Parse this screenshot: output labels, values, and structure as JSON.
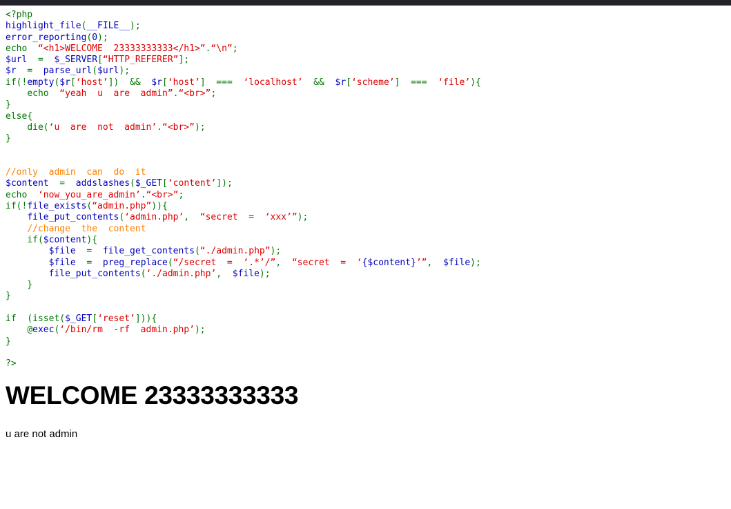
{
  "chrome": {
    "top_bar_color": "#22222a"
  },
  "syntax_colors": {
    "default": "#0000BB",
    "keyword": "#007700",
    "string": "#DD0000",
    "comment": "#FF8000",
    "html": "#000000",
    "background": "#FFFFFF"
  },
  "source_code": {
    "language": "php",
    "lines": [
      [
        {
          "t": "&lt;?php",
          "c": "keyword"
        }
      ],
      [
        {
          "t": "highlight_file",
          "c": "default"
        },
        {
          "t": "(",
          "c": "keyword"
        },
        {
          "t": "__FILE__",
          "c": "default"
        },
        {
          "t": ")",
          "c": "keyword"
        },
        {
          "t": ";",
          "c": "keyword"
        }
      ],
      [
        {
          "t": "error_reporting",
          "c": "default"
        },
        {
          "t": "(",
          "c": "keyword"
        },
        {
          "t": "0",
          "c": "default"
        },
        {
          "t": ")",
          "c": "keyword"
        },
        {
          "t": ";",
          "c": "keyword"
        }
      ],
      [
        {
          "t": "echo ",
          "c": "keyword"
        },
        {
          "t": " “&lt;h1&gt;WELCOME  23333333333&lt;/h1&gt;”",
          "c": "string"
        },
        {
          "t": ".",
          "c": "keyword"
        },
        {
          "t": "“\\n”",
          "c": "string"
        },
        {
          "t": ";",
          "c": "keyword"
        }
      ],
      [
        {
          "t": "$url",
          "c": "default"
        },
        {
          "t": "  =  ",
          "c": "keyword"
        },
        {
          "t": "$_SERVER",
          "c": "default"
        },
        {
          "t": "[",
          "c": "keyword"
        },
        {
          "t": "“HTTP_REFERER”",
          "c": "string"
        },
        {
          "t": "]",
          "c": "keyword"
        },
        {
          "t": ";",
          "c": "keyword"
        }
      ],
      [
        {
          "t": "$r",
          "c": "default"
        },
        {
          "t": "  =  ",
          "c": "keyword"
        },
        {
          "t": "parse_url",
          "c": "default"
        },
        {
          "t": "(",
          "c": "keyword"
        },
        {
          "t": "$url",
          "c": "default"
        },
        {
          "t": ")",
          "c": "keyword"
        },
        {
          "t": ";",
          "c": "keyword"
        }
      ],
      [
        {
          "t": "if",
          "c": "keyword"
        },
        {
          "t": "(!",
          "c": "keyword"
        },
        {
          "t": "empty",
          "c": "default"
        },
        {
          "t": "(",
          "c": "keyword"
        },
        {
          "t": "$r",
          "c": "default"
        },
        {
          "t": "[",
          "c": "keyword"
        },
        {
          "t": "‘host’",
          "c": "string"
        },
        {
          "t": "])",
          "c": "keyword"
        },
        {
          "t": "  &amp;&amp;  ",
          "c": "keyword"
        },
        {
          "t": "$r",
          "c": "default"
        },
        {
          "t": "[",
          "c": "keyword"
        },
        {
          "t": "‘host’",
          "c": "string"
        },
        {
          "t": "]",
          "c": "keyword"
        },
        {
          "t": "  ===  ",
          "c": "keyword"
        },
        {
          "t": "‘localhost’",
          "c": "string"
        },
        {
          "t": "  &amp;&amp;  ",
          "c": "keyword"
        },
        {
          "t": "$r",
          "c": "default"
        },
        {
          "t": "[",
          "c": "keyword"
        },
        {
          "t": "‘scheme’",
          "c": "string"
        },
        {
          "t": "]",
          "c": "keyword"
        },
        {
          "t": "  ===  ",
          "c": "keyword"
        },
        {
          "t": "‘file’",
          "c": "string"
        },
        {
          "t": "){",
          "c": "keyword"
        }
      ],
      [
        {
          "t": "    ",
          "c": "keyword"
        },
        {
          "t": "echo ",
          "c": "keyword"
        },
        {
          "t": " “yeah  u  are  admin”",
          "c": "string"
        },
        {
          "t": ".",
          "c": "keyword"
        },
        {
          "t": "“&lt;br&gt;”",
          "c": "string"
        },
        {
          "t": ";",
          "c": "keyword"
        }
      ],
      [
        {
          "t": "}",
          "c": "keyword"
        }
      ],
      [
        {
          "t": "else",
          "c": "keyword"
        },
        {
          "t": "{",
          "c": "keyword"
        }
      ],
      [
        {
          "t": "    ",
          "c": "keyword"
        },
        {
          "t": "die",
          "c": "keyword"
        },
        {
          "t": "(",
          "c": "keyword"
        },
        {
          "t": "‘u  are  not  admin’",
          "c": "string"
        },
        {
          "t": ".",
          "c": "keyword"
        },
        {
          "t": "“&lt;br&gt;”",
          "c": "string"
        },
        {
          "t": ")",
          "c": "keyword"
        },
        {
          "t": ";",
          "c": "keyword"
        }
      ],
      [
        {
          "t": "}",
          "c": "keyword"
        }
      ],
      [],
      [],
      [
        {
          "t": "//only  admin  can  do  it",
          "c": "comment"
        }
      ],
      [
        {
          "t": "$content",
          "c": "default"
        },
        {
          "t": "  =  ",
          "c": "keyword"
        },
        {
          "t": "addslashes",
          "c": "default"
        },
        {
          "t": "(",
          "c": "keyword"
        },
        {
          "t": "$_GET",
          "c": "default"
        },
        {
          "t": "[",
          "c": "keyword"
        },
        {
          "t": "‘content’",
          "c": "string"
        },
        {
          "t": "])",
          "c": "keyword"
        },
        {
          "t": ";",
          "c": "keyword"
        }
      ],
      [
        {
          "t": "echo ",
          "c": "keyword"
        },
        {
          "t": " ‘now_you_are_admin’",
          "c": "string"
        },
        {
          "t": ".",
          "c": "keyword"
        },
        {
          "t": "“&lt;br&gt;”",
          "c": "string"
        },
        {
          "t": ";",
          "c": "keyword"
        }
      ],
      [
        {
          "t": "if",
          "c": "keyword"
        },
        {
          "t": "(!",
          "c": "keyword"
        },
        {
          "t": "file_exists",
          "c": "default"
        },
        {
          "t": "(",
          "c": "keyword"
        },
        {
          "t": "“admin.php”",
          "c": "string"
        },
        {
          "t": ")){",
          "c": "keyword"
        }
      ],
      [
        {
          "t": "    ",
          "c": "keyword"
        },
        {
          "t": "file_put_contents",
          "c": "default"
        },
        {
          "t": "(",
          "c": "keyword"
        },
        {
          "t": "‘admin.php’",
          "c": "string"
        },
        {
          "t": ",  ",
          "c": "keyword"
        },
        {
          "t": "“secret  =  ‘xxx’”",
          "c": "string"
        },
        {
          "t": ")",
          "c": "keyword"
        },
        {
          "t": ";",
          "c": "keyword"
        }
      ],
      [
        {
          "t": "    ",
          "c": "keyword"
        },
        {
          "t": "//change  the  content",
          "c": "comment"
        }
      ],
      [
        {
          "t": "    ",
          "c": "keyword"
        },
        {
          "t": "if",
          "c": "keyword"
        },
        {
          "t": "(",
          "c": "keyword"
        },
        {
          "t": "$content",
          "c": "default"
        },
        {
          "t": "){",
          "c": "keyword"
        }
      ],
      [
        {
          "t": "        ",
          "c": "keyword"
        },
        {
          "t": "$file",
          "c": "default"
        },
        {
          "t": "  =  ",
          "c": "keyword"
        },
        {
          "t": "file_get_contents",
          "c": "default"
        },
        {
          "t": "(",
          "c": "keyword"
        },
        {
          "t": "“./admin.php”",
          "c": "string"
        },
        {
          "t": ")",
          "c": "keyword"
        },
        {
          "t": ";",
          "c": "keyword"
        }
      ],
      [
        {
          "t": "        ",
          "c": "keyword"
        },
        {
          "t": "$file",
          "c": "default"
        },
        {
          "t": "  =  ",
          "c": "keyword"
        },
        {
          "t": "preg_replace",
          "c": "default"
        },
        {
          "t": "(",
          "c": "keyword"
        },
        {
          "t": "“/secret  =  ‘.*’/”",
          "c": "string"
        },
        {
          "t": ",  ",
          "c": "keyword"
        },
        {
          "t": "“secret  =  ‘",
          "c": "string"
        },
        {
          "t": "{$content}",
          "c": "default"
        },
        {
          "t": "’”",
          "c": "string"
        },
        {
          "t": ",  ",
          "c": "keyword"
        },
        {
          "t": "$file",
          "c": "default"
        },
        {
          "t": ")",
          "c": "keyword"
        },
        {
          "t": ";",
          "c": "keyword"
        }
      ],
      [
        {
          "t": "        ",
          "c": "keyword"
        },
        {
          "t": "file_put_contents",
          "c": "default"
        },
        {
          "t": "(",
          "c": "keyword"
        },
        {
          "t": "‘./admin.php’",
          "c": "string"
        },
        {
          "t": ",  ",
          "c": "keyword"
        },
        {
          "t": "$file",
          "c": "default"
        },
        {
          "t": ")",
          "c": "keyword"
        },
        {
          "t": ";",
          "c": "keyword"
        }
      ],
      [
        {
          "t": "    }",
          "c": "keyword"
        }
      ],
      [
        {
          "t": "}",
          "c": "keyword"
        }
      ],
      [],
      [
        {
          "t": "if",
          "c": "keyword"
        },
        {
          "t": "  (",
          "c": "keyword"
        },
        {
          "t": "isset",
          "c": "keyword"
        },
        {
          "t": "(",
          "c": "keyword"
        },
        {
          "t": "$_GET",
          "c": "default"
        },
        {
          "t": "[",
          "c": "keyword"
        },
        {
          "t": "‘reset’",
          "c": "string"
        },
        {
          "t": "])){",
          "c": "keyword"
        }
      ],
      [
        {
          "t": "    ",
          "c": "keyword"
        },
        {
          "t": "@",
          "c": "keyword"
        },
        {
          "t": "exec",
          "c": "default"
        },
        {
          "t": "(",
          "c": "keyword"
        },
        {
          "t": "‘/bin/rm  -rf  admin.php’",
          "c": "string"
        },
        {
          "t": ")",
          "c": "keyword"
        },
        {
          "t": ";",
          "c": "keyword"
        }
      ],
      [
        {
          "t": "}",
          "c": "keyword"
        }
      ],
      [],
      [
        {
          "t": "?&gt;",
          "c": "keyword"
        }
      ]
    ]
  },
  "output": {
    "heading": "WELCOME 23333333333",
    "message": "u are not admin"
  }
}
